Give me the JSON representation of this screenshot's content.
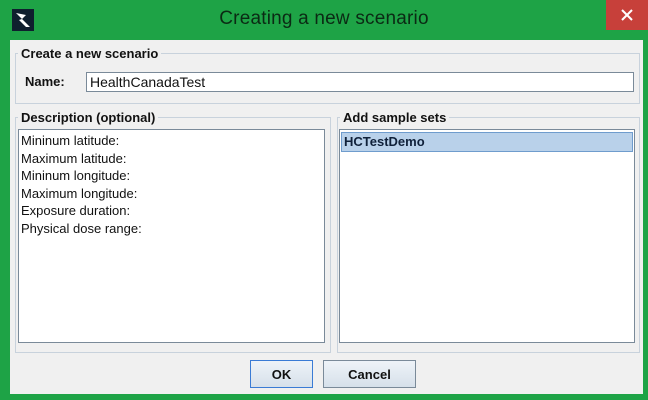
{
  "window": {
    "title": "Creating a new scenario",
    "icons": {
      "app": "app-logo-icon",
      "close": "close-icon"
    },
    "colors": {
      "titlebar": "#1ea346",
      "close": "#c7403a",
      "selection": "#b9d1ea"
    }
  },
  "create_group": {
    "legend": "Create a new scenario",
    "name_label": "Name:",
    "name_value": "HealthCanadaTest"
  },
  "description_group": {
    "legend": "Description (optional)",
    "lines": [
      "Mininum latitude:",
      "Maximum latitude:",
      "Mininum longitude:",
      "Maximum longitude:",
      "Exposure duration:",
      "Physical dose range:"
    ]
  },
  "samples_group": {
    "legend": "Add sample sets",
    "items": [
      "HCTestDemo"
    ],
    "selected": "HCTestDemo"
  },
  "buttons": {
    "ok": "OK",
    "cancel": "Cancel"
  }
}
